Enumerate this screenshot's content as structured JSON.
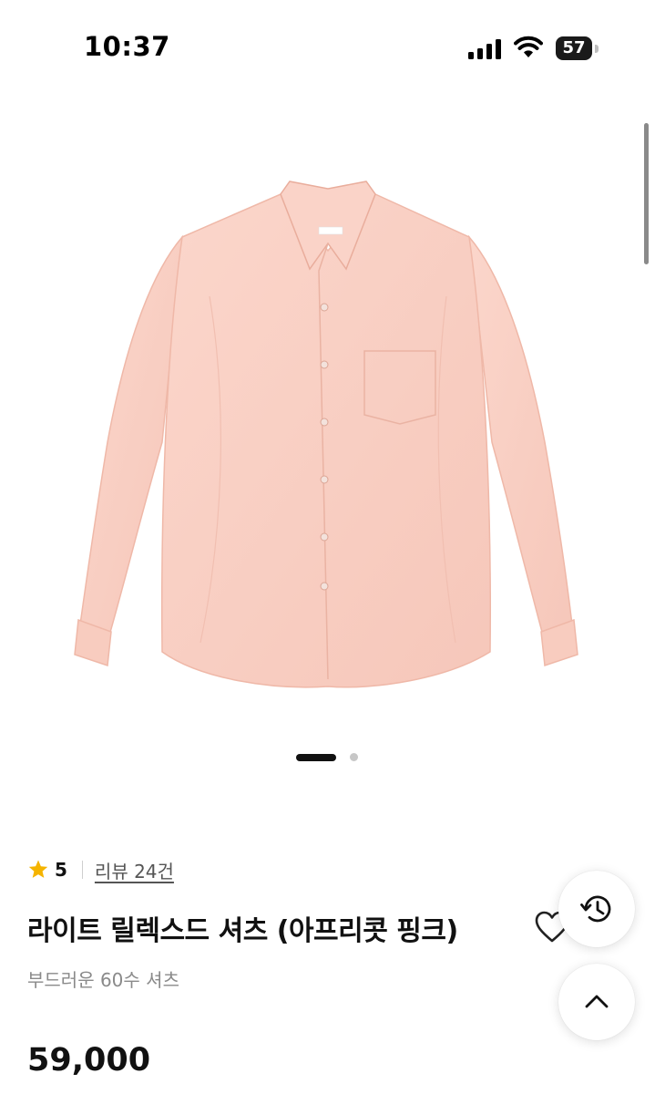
{
  "status_bar": {
    "time": "10:37",
    "battery": "57",
    "icons": [
      "cellular-signal-icon",
      "wifi-icon",
      "battery-icon"
    ]
  },
  "gallery": {
    "image_alt": "product-photo-pink-shirt",
    "slide_count": 2,
    "active_slide": 1
  },
  "product": {
    "rating": "5",
    "review_link": "리뷰 24건",
    "name": "라이트 릴렉스드 셔츠 (아프리콧 핑크)",
    "description": "부드러운 60수 셔츠",
    "price": "59,000"
  },
  "actions": {
    "icons": [
      "heart-icon",
      "share-icon",
      "history-icon",
      "arrow-up-icon"
    ]
  },
  "colors": {
    "accent_star": "#F5B400",
    "shirt": "#F9CFC3",
    "text_primary": "#111111",
    "text_secondary": "#8A8A8A"
  }
}
